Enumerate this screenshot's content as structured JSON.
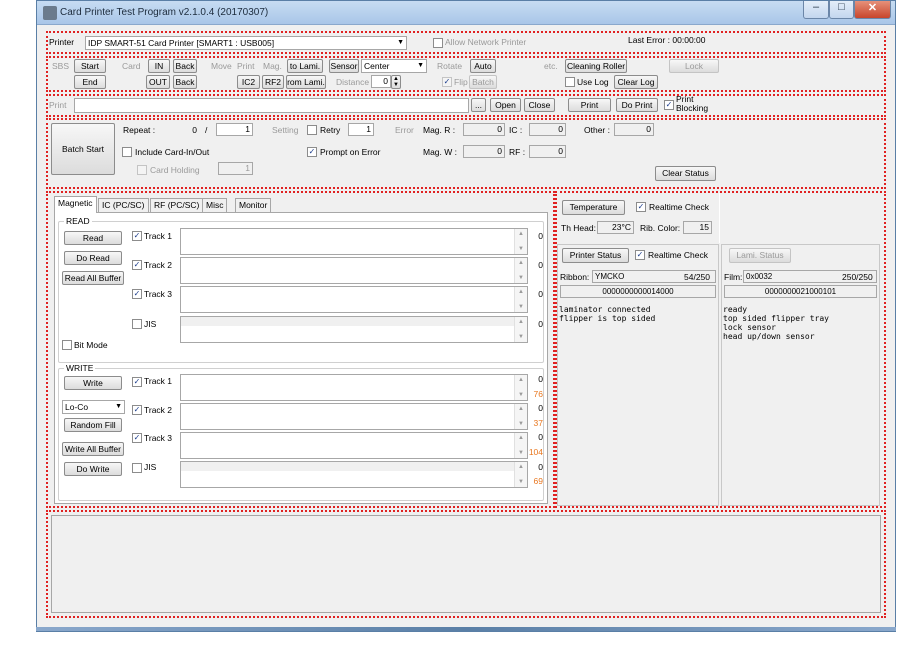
{
  "window": {
    "title": "Card Printer Test Program v2.1.0.4 (20170307)",
    "min": "–",
    "max": "□",
    "close": "✕"
  },
  "printer_row": {
    "label": "Printer",
    "selected": "IDP SMART-51 Card Printer  [SMART1 : USB005]",
    "allow_network": "Allow Network Printer",
    "last_error": "Last Error : 00:00:00"
  },
  "control": {
    "sbs_label": "SBS",
    "start": "Start",
    "end": "End",
    "card_label": "Card",
    "in": "IN",
    "back1": "Back",
    "out": "OUT",
    "back2": "Back",
    "move_label": "Move",
    "print_label": "Print",
    "mag_label": "Mag.",
    "to_lami": "to Lami.",
    "ic2": "IC2",
    "rf2": "RF2",
    "from_lami": "rom Lami.",
    "sensor": "Sensor",
    "center": "Center",
    "distance_label": "Distance",
    "distance_value": "0",
    "rotate_label": "Rotate",
    "auto": "Auto",
    "flip": "Flip",
    "batch": "Batch",
    "etc_label": "etc.",
    "cleaning_roller": "Cleaning Roller",
    "lock": "Lock",
    "use_log": "Use Log",
    "clear_log": "Clear Log"
  },
  "print_row": {
    "label": "Print",
    "path": "",
    "browse": "...",
    "open": "Open",
    "close": "Close",
    "print": "Print",
    "do_print": "Do Print",
    "print_blocking": "Print Blocking"
  },
  "batch": {
    "batch_start": "Batch Start",
    "repeat_label": "Repeat :",
    "repeat_done": "0",
    "slash": "/",
    "repeat_total": "1",
    "include_card": "Include Card-In/Out",
    "card_holding": "Card Holding",
    "card_holding_value": "1",
    "setting_label": "Setting",
    "retry": "Retry",
    "retry_value": "1",
    "prompt_on_error": "Prompt on Error",
    "error_label": "Error",
    "mag_r": "Mag. R :",
    "mag_r_value": "0",
    "ic": "IC :",
    "ic_value": "0",
    "other": "Other :",
    "other_value": "0",
    "mag_w": "Mag. W :",
    "mag_w_value": "0",
    "rf": "RF :",
    "rf_value": "0",
    "clear_status": "Clear Status"
  },
  "tabs": [
    "Magnetic",
    "IC (PC/SC)",
    "RF (PC/SC)",
    "Misc",
    "Monitor"
  ],
  "magnetic": {
    "read_group": "READ",
    "read": "Read",
    "do_read": "Do Read",
    "read_all_buffer": "Read All Buffer",
    "read_tracks": [
      {
        "label": "Track 1",
        "count": "0"
      },
      {
        "label": "Track 2",
        "count": "0"
      },
      {
        "label": "Track 3",
        "count": "0"
      },
      {
        "label": "JIS",
        "count": "0"
      }
    ],
    "bit_mode": "Bit Mode",
    "write_group": "WRITE",
    "write": "Write",
    "coercivity": "Lo-Co",
    "random_fill": "Random Fill",
    "write_all_buffer": "Write All Buffer",
    "do_write": "Do Write",
    "write_tracks": [
      {
        "label": "Track 1",
        "count": "0",
        "max": "76"
      },
      {
        "label": "Track 2",
        "count": "0",
        "max": "37"
      },
      {
        "label": "Track 3",
        "count": "0",
        "max": "104"
      },
      {
        "label": "JIS",
        "count": "0",
        "max": "69"
      }
    ]
  },
  "status": {
    "temperature": "Temperature",
    "realtime_check": "Realtime Check",
    "th_head_label": "Th Head:",
    "th_head_value": "23°C",
    "rib_color_label": "Rib. Color:",
    "rib_color_value": "15",
    "printer_status": "Printer Status",
    "realtime_check2": "Realtime Check",
    "ribbon_label": "Ribbon:",
    "ribbon_type": "YMCKO",
    "ribbon_count": "54/250",
    "ribbon_serial": "0000000000014000",
    "printer_log": "laminator connected\nflipper is top sided",
    "lami_status": "Lami. Status",
    "film_label": "Film:",
    "film_type": "0x0032",
    "film_count": "250/250",
    "film_serial": "0000000021000101",
    "lami_log": "ready\ntop sided flipper tray\nlock sensor\nhead up/down sensor"
  },
  "log": {
    "text": ""
  },
  "colors": {
    "highlight": "#e02222",
    "accent_orange": "#e8761e"
  }
}
